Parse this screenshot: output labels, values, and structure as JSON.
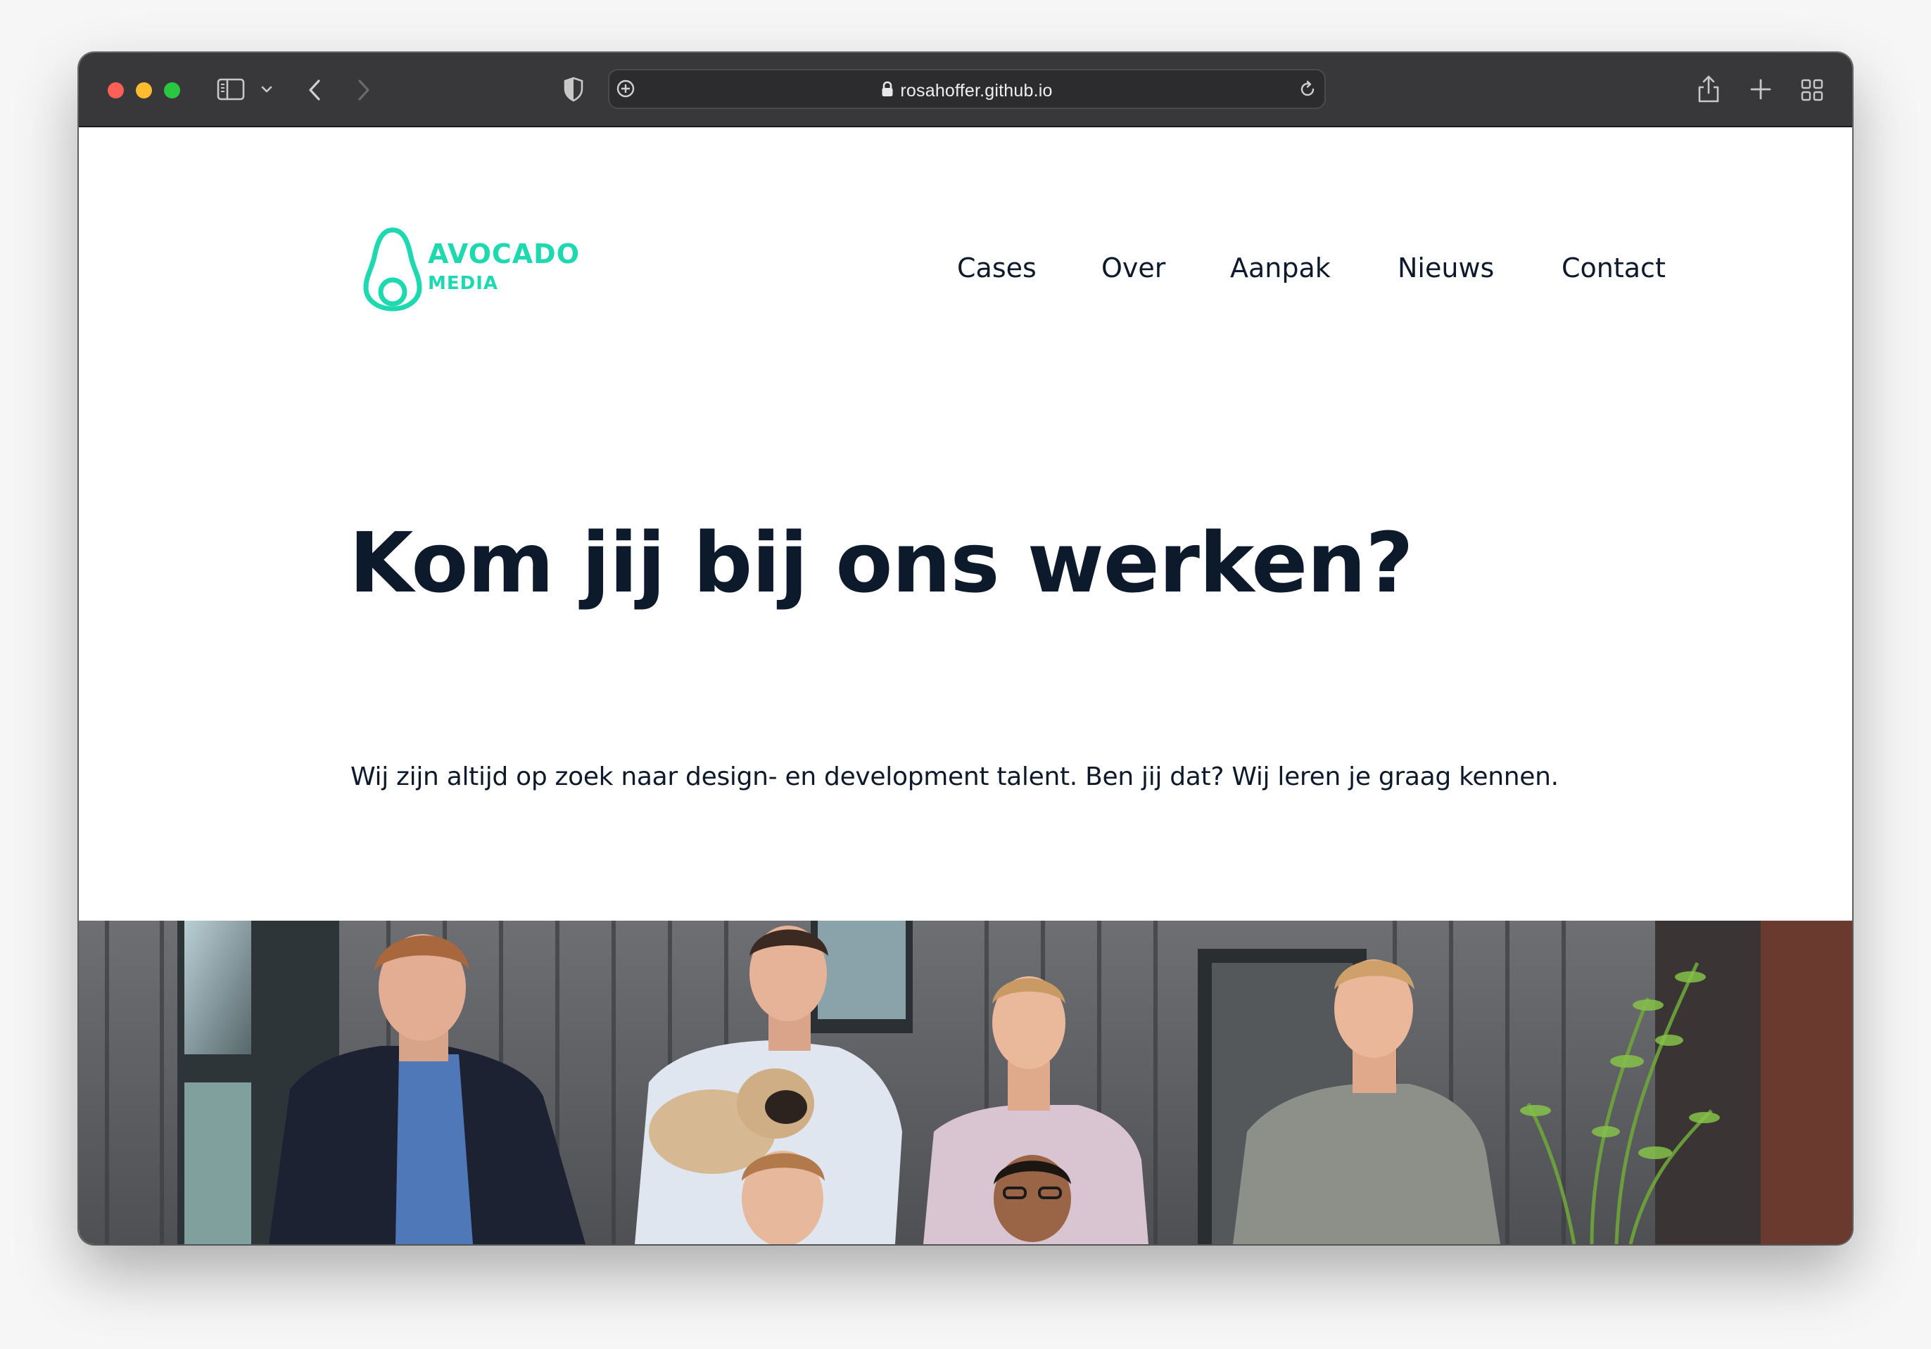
{
  "browser": {
    "url": "rosahoffer.github.io"
  },
  "brand": {
    "name_line1": "AVOCADO",
    "name_line2": "MEDIA",
    "color": "#1ed8b0"
  },
  "nav": {
    "items": [
      {
        "label": "Cases"
      },
      {
        "label": "Over"
      },
      {
        "label": "Aanpak"
      },
      {
        "label": "Nieuws"
      },
      {
        "label": "Contact"
      }
    ]
  },
  "hero": {
    "title": "Kom jij bij ons werken?",
    "subtitle": "Wij zijn altijd op zoek naar design- en development talent. Ben jij dat? Wij leren je graag kennen."
  },
  "icons": {
    "sidebar": "sidebar-icon",
    "back": "chevron-left-icon",
    "forward": "chevron-right-icon",
    "shield": "shield-icon",
    "site_settings": "plus-circle-icon",
    "lock": "lock-icon",
    "reload": "reload-icon",
    "share": "share-icon",
    "new_tab": "plus-icon",
    "tab_overview": "grid-icon"
  },
  "colors": {
    "text_dark": "#0c1a2c",
    "toolbar": "#38383b"
  }
}
